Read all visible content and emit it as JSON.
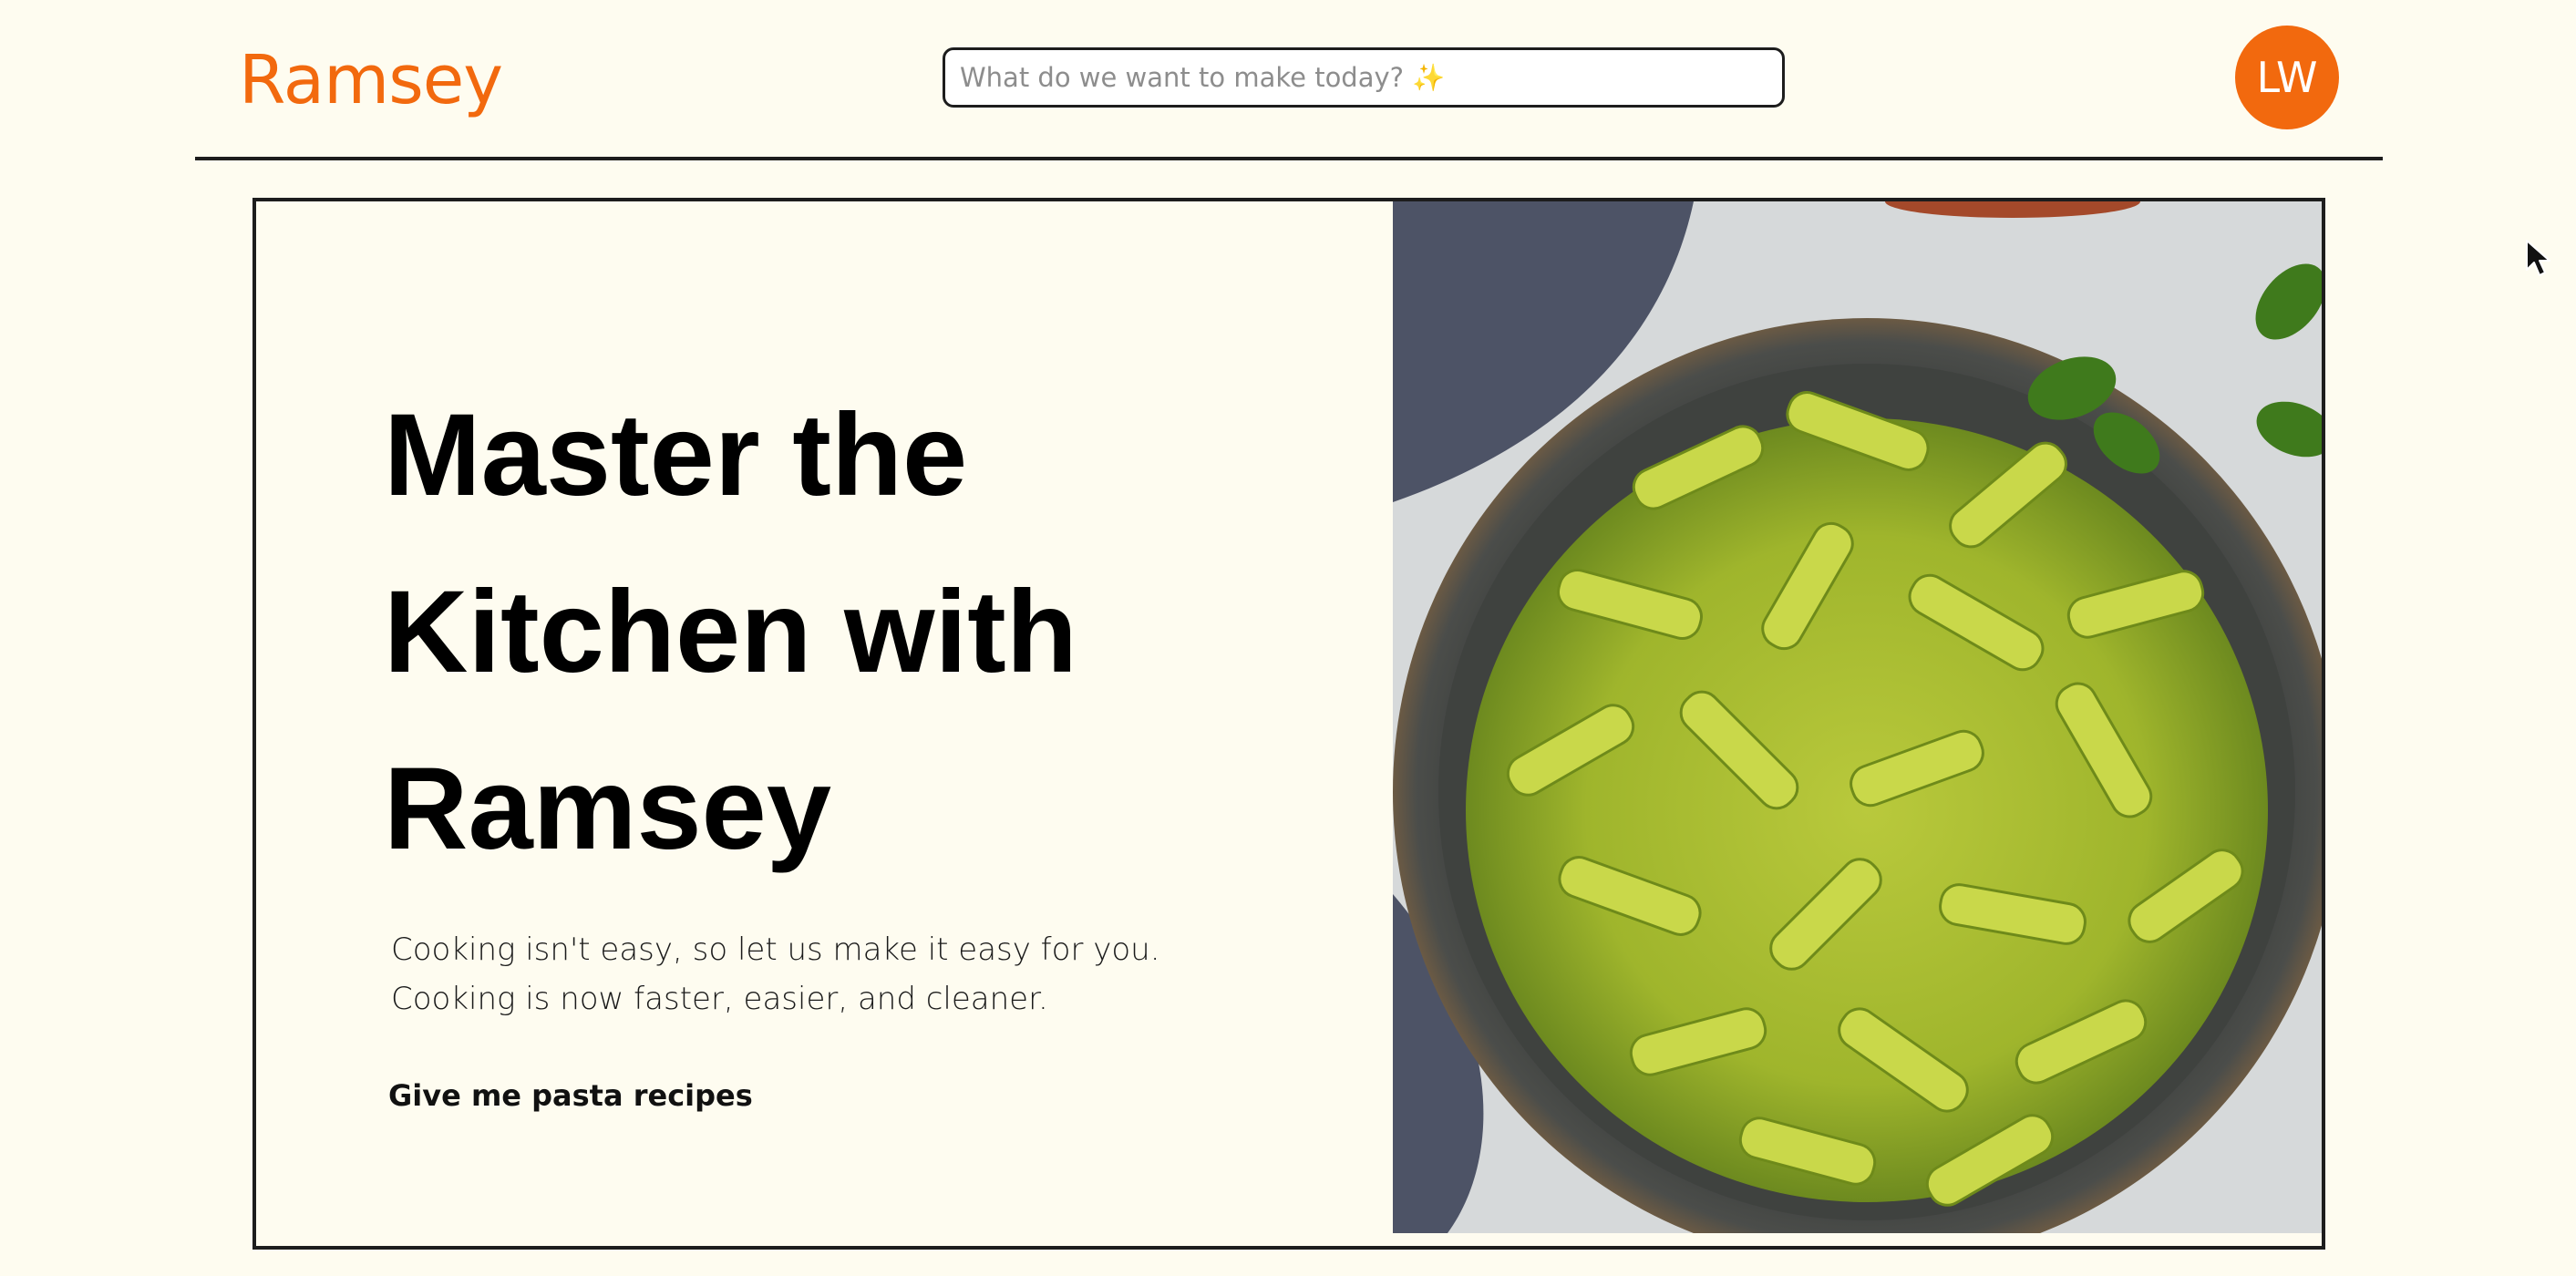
{
  "header": {
    "logo": "Ramsey",
    "search_placeholder": "What do we want to make today? ✨",
    "avatar_initials": "LW"
  },
  "hero": {
    "title_lines": [
      "Master the",
      "Kitchen with",
      "Ramsey"
    ],
    "subtitle_lines": [
      "Cooking isn't easy, so let us make it easy for you.",
      "Cooking is now faster, easier, and cleaner."
    ],
    "cta_label": "Give me pasta recipes",
    "image_icon": "pesto-pasta-plate-image"
  },
  "colors": {
    "brand": "#f2690e",
    "background": "#fefcf0",
    "border": "#1d1d1d"
  }
}
